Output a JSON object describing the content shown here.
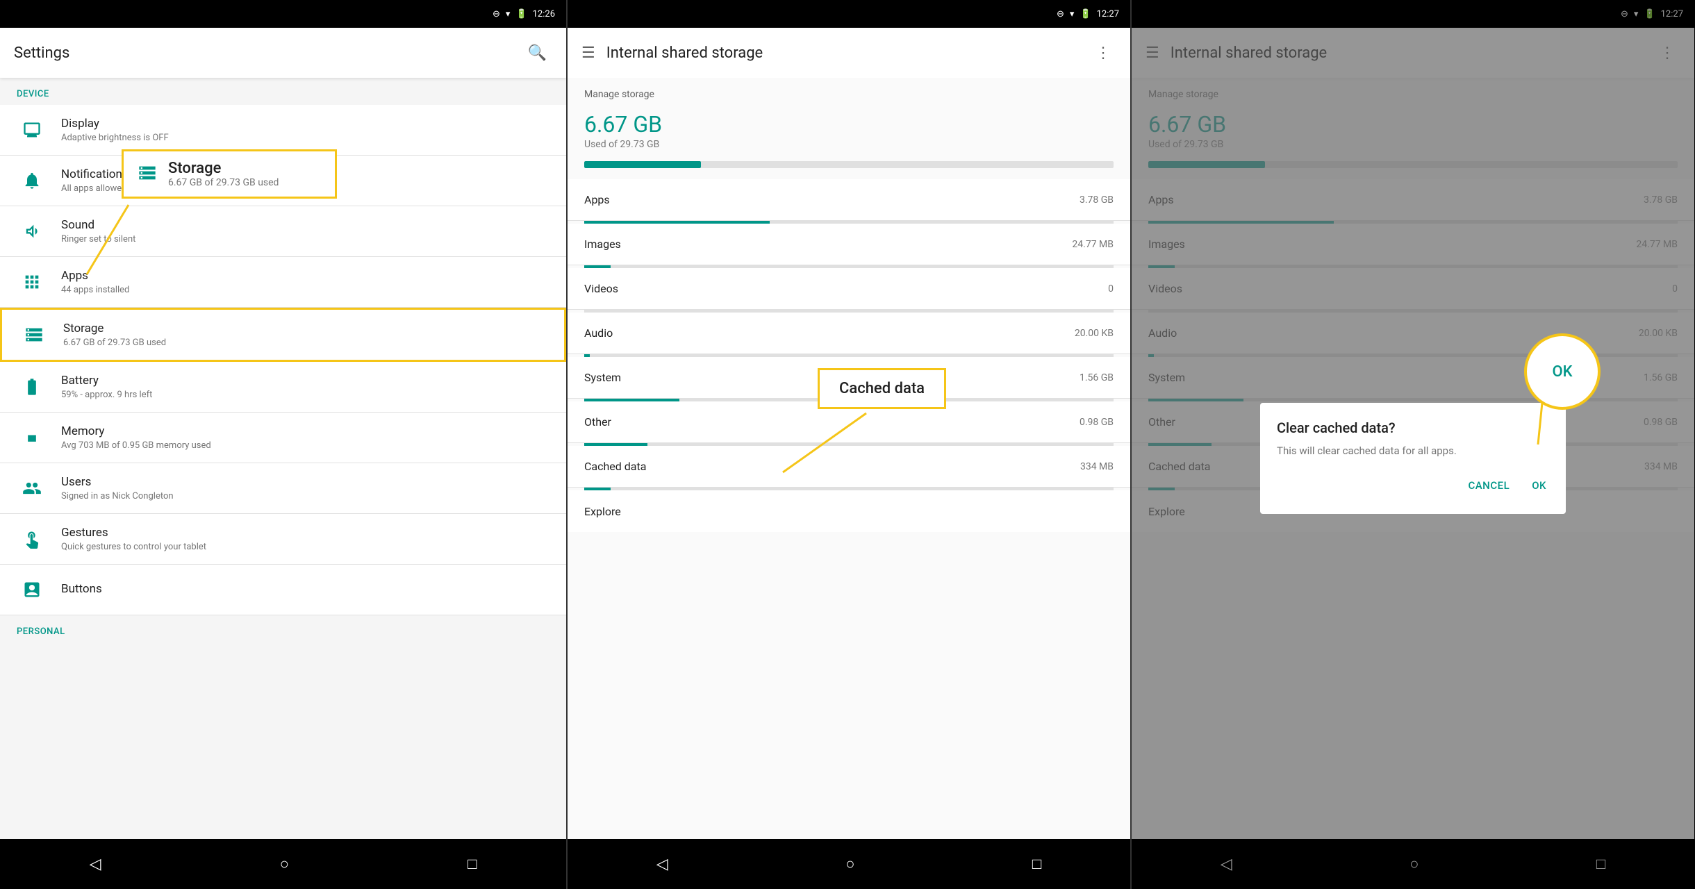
{
  "panel1": {
    "status": {
      "time": "12:26",
      "icons": [
        "signal",
        "wifi",
        "battery"
      ]
    },
    "app_bar": {
      "title": "Settings",
      "search_icon": "🔍"
    },
    "device_section": "Device",
    "items": [
      {
        "id": "display",
        "title": "Display",
        "subtitle": "Adaptive brightness is OFF"
      },
      {
        "id": "notifications",
        "title": "Notifications",
        "subtitle": "All apps allowed to se..."
      },
      {
        "id": "sound",
        "title": "Sound",
        "subtitle": "Ringer set to silent"
      },
      {
        "id": "apps",
        "title": "Apps",
        "subtitle": "44 apps installed"
      },
      {
        "id": "storage",
        "title": "Storage",
        "subtitle": "6.67 GB of 29.73 GB used",
        "highlighted": true
      },
      {
        "id": "battery",
        "title": "Battery",
        "subtitle": "59% - approx. 9 hrs left"
      },
      {
        "id": "memory",
        "title": "Memory",
        "subtitle": "Avg 703 MB of 0.95 GB memory used"
      },
      {
        "id": "users",
        "title": "Users",
        "subtitle": "Signed in as Nick Congleton"
      },
      {
        "id": "gestures",
        "title": "Gestures",
        "subtitle": "Quick gestures to control your tablet"
      },
      {
        "id": "buttons",
        "title": "Buttons",
        "subtitle": ""
      }
    ],
    "personal_section": "Personal",
    "annotation": {
      "title": "Storage",
      "subtitle": "6.67 GB of 29.73 GB used"
    }
  },
  "panel2": {
    "status": {
      "time": "12:27"
    },
    "app_bar": {
      "title": "Internal shared storage"
    },
    "manage_storage": "Manage storage",
    "used_gb": "6.67 GB",
    "used_of": "Used of 29.73 GB",
    "bar_percent": 22,
    "rows": [
      {
        "label": "Apps",
        "value": "3.78 GB",
        "bar_percent": 35
      },
      {
        "label": "Images",
        "value": "24.77 MB",
        "bar_percent": 5
      },
      {
        "label": "Videos",
        "value": "0",
        "bar_percent": 0
      },
      {
        "label": "Audio",
        "value": "20.00 KB",
        "bar_percent": 1
      },
      {
        "label": "System",
        "value": "1.56 GB",
        "bar_percent": 18
      },
      {
        "label": "Other",
        "value": "0.98 GB",
        "bar_percent": 12
      },
      {
        "label": "Cached data",
        "value": "334 MB",
        "bar_percent": 5
      },
      {
        "label": "Explore",
        "value": "",
        "bar_percent": 0
      }
    ],
    "cached_annotation": "Cached data"
  },
  "panel3": {
    "status": {
      "time": "12:27"
    },
    "app_bar": {
      "title": "Internal shared storage"
    },
    "manage_storage": "Manage storage",
    "used_gb": "6.67 GB",
    "used_of": "Used of 29.73 GB",
    "bar_percent": 22,
    "rows": [
      {
        "label": "Apps",
        "value": "3.78 GB",
        "bar_percent": 35
      },
      {
        "label": "Images",
        "value": "24.77 MB",
        "bar_percent": 5
      },
      {
        "label": "Videos",
        "value": "0",
        "bar_percent": 0
      },
      {
        "label": "Audio",
        "value": "20.00 KB",
        "bar_percent": 1
      },
      {
        "label": "System",
        "value": "1.56 GB",
        "bar_percent": 18
      },
      {
        "label": "Other",
        "value": "0.98 GB",
        "bar_percent": 12
      },
      {
        "label": "Cached data",
        "value": "334 MB",
        "bar_percent": 5
      },
      {
        "label": "Explore",
        "value": "",
        "bar_percent": 0
      }
    ],
    "dialog": {
      "title": "Clear cached data?",
      "message": "This will clear cached data for all apps.",
      "cancel": "CANCEL",
      "ok": "OK",
      "ok_circle": "OK"
    }
  },
  "nav": {
    "back": "◁",
    "home": "○",
    "recent": "□"
  }
}
